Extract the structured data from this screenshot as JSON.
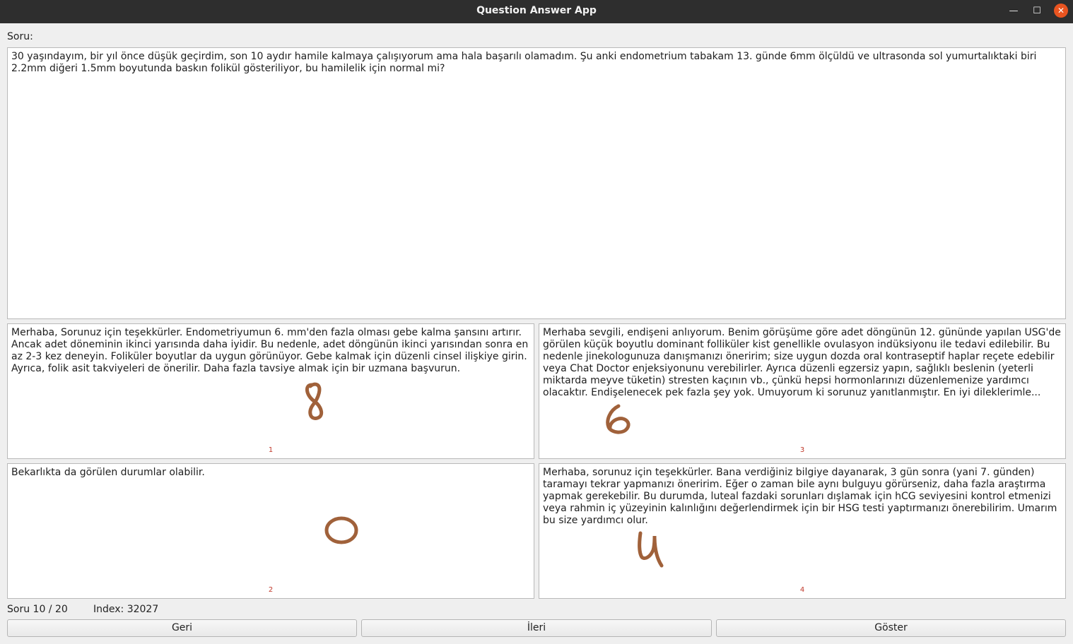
{
  "window": {
    "title": "Question Answer App",
    "minimize_glyph": "—",
    "maximize_glyph": "☐",
    "close_glyph": "✕"
  },
  "question": {
    "label": "Soru:",
    "text": "30 yaşındayım, bir yıl önce düşük geçirdim, son 10 aydır hamile kalmaya çalışıyorum ama hala başarılı olamadım. Şu anki endometrium tabakam 13. günde 6mm ölçüldü ve ultrasonda sol yumurtalıktaki biri 2.2mm diğeri 1.5mm boyutunda baskın folikül gösteriliyor, bu hamilelik için normal mi?"
  },
  "answers": [
    {
      "text": "Merhaba, Sorunuz için teşekkürler. Endometriyumun 6. mm'den fazla olması gebe kalma şansını artırır. Ancak adet döneminin ikinci yarısında daha iyidir. Bu nedenle, adet döngünün ikinci yarısından sonra en az 2-3 kez deneyin. Foliküler boyutlar da uygun görünüyor. Gebe kalmak için düzenli cinsel ilişkiye girin. Ayrıca, folik asit takviyeleri de önerilir. Daha fazla tavsiye almak için bir uzmana başvurun.",
      "number": "1",
      "handwritten_score": "8"
    },
    {
      "text": "Bekarlıkta da görülen durumlar olabilir.",
      "number": "2",
      "handwritten_score": "0"
    },
    {
      "text": "Merhaba sevgili, endişeni anlıyorum. Benim görüşüme göre adet döngünün 12. gününde yapılan USG'de görülen küçük boyutlu dominant folliküler kist genellikle ovulasyon indüksiyonu ile tedavi edilebilir. Bu nedenle jinekologunuza danışmanızı öneririm; size uygun dozda oral kontraseptif haplar reçete edebilir veya Chat Doctor enjeksiyonunu verebilirler. Ayrıca düzenli egzersiz yapın, sağlıklı beslenin (yeterli miktarda meyve tüketin) stresten kaçının vb., çünkü hepsi hormonlarınızı düzenlemenize yardımcı olacaktır. Endişelenecek pek fazla şey yok. Umuyorum ki sorunuz yanıtlanmıştır. En iyi dileklerimle...",
      "number": "3",
      "handwritten_score": "6"
    },
    {
      "text": "Merhaba, sorunuz için teşekkürler. Bana verdiğiniz bilgiye dayanarak, 3 gün sonra (yani 7. günden) taramayı tekrar yapmanızı öneririm. Eğer o zaman bile aynı bulguyu görürseniz, daha fazla araştırma yapmak gerekebilir. Bu durumda, luteal fazdaki sorunları dışlamak için hCG seviyesini kontrol etmenizi veya rahmin iç yüzeyinin kalınlığını değerlendirmek için bir HSG testi yaptırmanızı önerebilirim. Umarım bu size yardımcı olur.",
      "number": "4",
      "handwritten_score": "4"
    }
  ],
  "status": {
    "counter": "Soru 10 / 20",
    "index": "Index: 32027"
  },
  "buttons": {
    "back": "Geri",
    "next": "İleri",
    "show": "Göster"
  },
  "colors": {
    "titlebar": "#2e2e2e",
    "close_button": "#e95420",
    "handwriting": "#a0613a",
    "answer_number": "#c0392b"
  }
}
